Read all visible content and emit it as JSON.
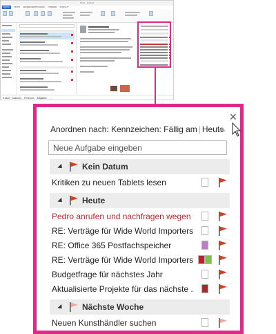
{
  "outlook": {
    "title": "Inbox - Outlook",
    "ribbon_tabs": [
      "DATEI",
      "START",
      "SENDEN/EMPFANGEN",
      "ORDNER",
      "ANSICHT"
    ],
    "status_bar": [
      "E-Mail",
      "Kalender",
      "Personen",
      "Aufgaben",
      "..."
    ]
  },
  "todo": {
    "arrange_label": "Anordnen nach: Kennzeichen: Fällig am",
    "arrange_value": "Heute",
    "new_task_placeholder": "Neue Aufgabe eingeben",
    "groups": [
      {
        "label": "Kein Datum",
        "flag_color": "#d9411e",
        "tasks": [
          {
            "title": "Kritiken zu neuen Tablets lesen",
            "overdue": false,
            "categories": [],
            "flag_color": "#d9411e"
          }
        ]
      },
      {
        "label": "Heute",
        "flag_color": "#d9411e",
        "tasks": [
          {
            "title": "Pedro anrufen und nachfragen wegen ...",
            "overdue": true,
            "categories": [],
            "flag_color": "#d9411e"
          },
          {
            "title": "RE: Verträge für Wide World Importers...",
            "overdue": false,
            "categories": [],
            "flag_color": "#d9411e"
          },
          {
            "title": "RE: Office 365 Postfachspeicher",
            "overdue": false,
            "categories": [
              "#b87fc6"
            ],
            "flag_color": "#d9411e"
          },
          {
            "title": "RE: Verträge für Wide World Importers...",
            "overdue": false,
            "categories": [
              "#b0252f",
              "#7fbf4a"
            ],
            "flag_color": "#d9411e"
          },
          {
            "title": "Budgetfrage für nächstes Jahr",
            "overdue": false,
            "categories": [],
            "flag_color": "#d9411e"
          },
          {
            "title": "Aktualisierte Projekte für das nächste ...",
            "overdue": false,
            "categories": [
              "#b0252f"
            ],
            "flag_color": "#d9411e"
          }
        ]
      },
      {
        "label": "Nächste Woche",
        "flag_color": "#f0a898",
        "tasks": [
          {
            "title": "Neuen Kunsthändler suchen",
            "overdue": false,
            "categories": [],
            "flag_color": "#f0a898"
          }
        ]
      }
    ]
  },
  "colors": {
    "highlight": "#e0278b",
    "overdue_text": "#c0272d",
    "flag": "#d9411e"
  }
}
